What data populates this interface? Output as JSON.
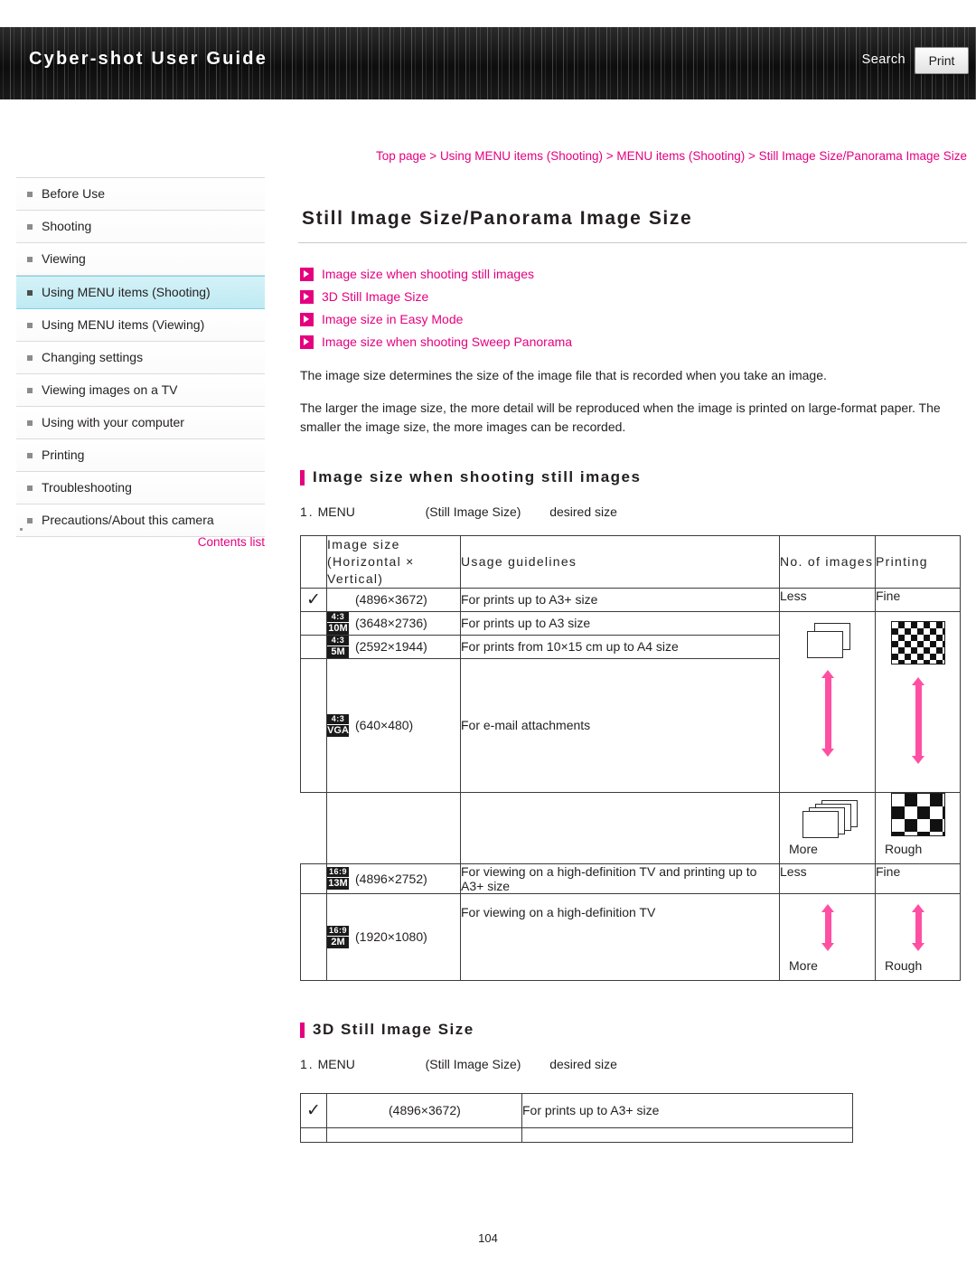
{
  "header": {
    "title": "Cyber-shot User Guide",
    "search_label": "Search",
    "print_label": "Print"
  },
  "breadcrumb": {
    "items": [
      "Top page",
      "Using MENU items (Shooting)",
      "MENU items (Shooting)",
      "Still Image Size/Panorama Image Size"
    ],
    "separator": ">"
  },
  "sidebar": {
    "items": [
      {
        "label": "Before Use",
        "active": false
      },
      {
        "label": "Shooting",
        "active": false
      },
      {
        "label": "Viewing",
        "active": false
      },
      {
        "label": "Using MENU items (Shooting)",
        "active": true
      },
      {
        "label": "Using MENU items (Viewing)",
        "active": false
      },
      {
        "label": "Changing settings",
        "active": false
      },
      {
        "label": "Viewing images on a TV",
        "active": false
      },
      {
        "label": "Using with your computer",
        "active": false
      },
      {
        "label": "Printing",
        "active": false
      },
      {
        "label": "Troubleshooting",
        "active": false
      },
      {
        "label": "Precautions/About this camera",
        "active": false
      }
    ],
    "contents_list": "Contents list"
  },
  "main": {
    "page_title": "Still Image Size/Panorama Image Size",
    "jump_links": [
      "Image size when shooting still images",
      "3D Still Image Size",
      "Image size in Easy Mode",
      "Image size when shooting Sweep Panorama"
    ],
    "paragraphs": [
      "The image size determines the size of the image file that is recorded when you take an image.",
      "The larger the image size, the more detail will be reproduced when the image is printed on large-format paper. The smaller the image size, the more images can be recorded."
    ],
    "section1": {
      "title": "Image size when shooting still images",
      "step": {
        "number": "1.",
        "menu": "MENU",
        "item": "(Still Image Size)",
        "tail": "desired size"
      },
      "table": {
        "headers": {
          "image_size": "Image size (Horizontal × Vertical)",
          "usage": "Usage guidelines",
          "no_images": "No. of images",
          "printing": "Printing"
        },
        "rows": [
          {
            "icon": "check",
            "badge_top": "",
            "badge_bot": "",
            "size": "(4896×3672)",
            "usage": "For prints up to A3+ size",
            "no_label": "Less",
            "pr_label": "Fine"
          },
          {
            "icon": "badge",
            "badge_top": "4:3",
            "badge_bot": "10M",
            "size": "(3648×2736)",
            "usage": "For prints up to A3 size",
            "no_label": "",
            "pr_label": ""
          },
          {
            "icon": "badge",
            "badge_top": "4:3",
            "badge_bot": "5M",
            "size": "(2592×1944)",
            "usage": "For prints from 10×15 cm up to A4 size",
            "no_label": "",
            "pr_label": ""
          },
          {
            "icon": "badge",
            "badge_top": "4:3",
            "badge_bot": "VGA",
            "size": "(640×480)",
            "usage": "For e-mail attachments",
            "no_label": "More",
            "pr_label": "Rough"
          },
          {
            "icon": "badge",
            "badge_top": "16:9",
            "badge_bot": "13M",
            "size": "(4896×2752)",
            "usage": "For viewing on a high-definition TV and printing up to A3+ size",
            "no_label": "Less",
            "pr_label": "Fine"
          },
          {
            "icon": "badge",
            "badge_top": "16:9",
            "badge_bot": "2M",
            "size": "(1920×1080)",
            "usage": "For viewing on a high-definition TV",
            "no_label": "More",
            "pr_label": "Rough"
          }
        ]
      }
    },
    "section2": {
      "title": "3D Still Image Size",
      "step": {
        "number": "1.",
        "menu": "MENU",
        "item": "(Still Image Size)",
        "tail": "desired size"
      },
      "table": {
        "rows": [
          {
            "icon": "check",
            "size": "(4896×3672)",
            "usage": "For prints up to A3+ size"
          }
        ]
      }
    }
  },
  "page_number": "104"
}
